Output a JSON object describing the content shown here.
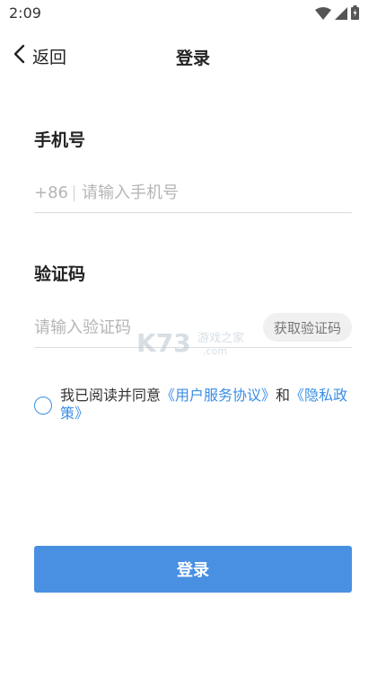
{
  "status_bar": {
    "time": "2:09"
  },
  "nav": {
    "back_label": "返回",
    "title": "登录"
  },
  "form": {
    "phone_label": "手机号",
    "phone_prefix": "+86",
    "phone_placeholder": "请输入手机号",
    "code_label": "验证码",
    "code_placeholder": "请输入验证码",
    "get_code_label": "获取验证码"
  },
  "agreement": {
    "prefix": "我已阅读并同意",
    "user_agreement": "《用户服务协议》",
    "conjunction": "和",
    "privacy_policy": "《隐私政策》"
  },
  "login_button_label": "登录",
  "watermark": {
    "text": "游戏之家",
    "sub": ".com"
  },
  "colors": {
    "accent": "#4a90e2",
    "link": "#3a8ee6"
  }
}
